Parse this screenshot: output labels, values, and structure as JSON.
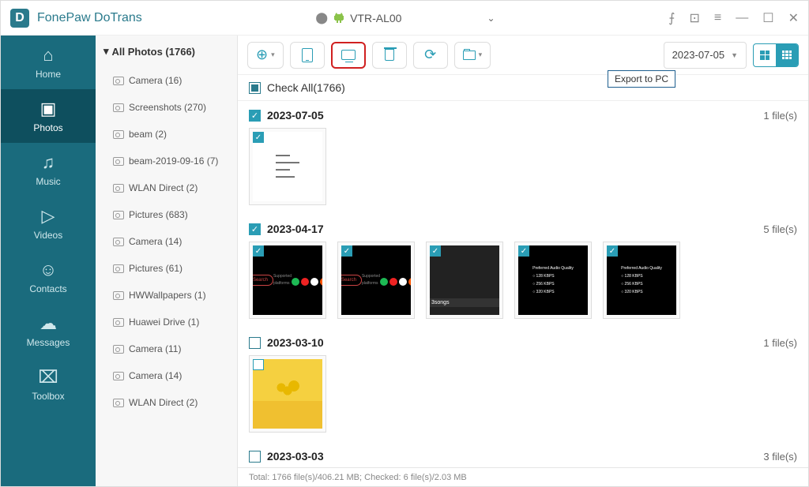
{
  "app": {
    "title": "FonePaw DoTrans"
  },
  "device": {
    "name": "VTR-AL00"
  },
  "nav": {
    "items": [
      {
        "label": "Home",
        "icon": "home"
      },
      {
        "label": "Photos",
        "icon": "photo",
        "active": true
      },
      {
        "label": "Music",
        "icon": "music"
      },
      {
        "label": "Videos",
        "icon": "video"
      },
      {
        "label": "Contacts",
        "icon": "contact"
      },
      {
        "label": "Messages",
        "icon": "message"
      },
      {
        "label": "Toolbox",
        "icon": "toolbox"
      }
    ]
  },
  "sidebar": {
    "header": "All Photos (1766)",
    "albums": [
      {
        "label": "Camera (16)"
      },
      {
        "label": "Screenshots (270)"
      },
      {
        "label": "beam (2)"
      },
      {
        "label": "beam-2019-09-16 (7)"
      },
      {
        "label": "WLAN Direct (2)"
      },
      {
        "label": "Pictures (683)"
      },
      {
        "label": "Camera (14)"
      },
      {
        "label": "Pictures (61)"
      },
      {
        "label": "HWWallpapers (1)"
      },
      {
        "label": "Huawei Drive (1)"
      },
      {
        "label": "Camera (11)"
      },
      {
        "label": "Camera (14)"
      },
      {
        "label": "WLAN Direct (2)"
      }
    ]
  },
  "toolbar": {
    "tooltip": "Export to PC",
    "date_filter": "2023-07-05"
  },
  "checkall": {
    "label": "Check All(1766)"
  },
  "groups": [
    {
      "date": "2023-07-05",
      "count": "1 file(s)",
      "checked": true,
      "thumbs": [
        {
          "checked": true,
          "style": "white"
        }
      ]
    },
    {
      "date": "2023-04-17",
      "count": "5 file(s)",
      "checked": true,
      "thumbs": [
        {
          "checked": true,
          "style": "dark1"
        },
        {
          "checked": true,
          "style": "dark1"
        },
        {
          "checked": true,
          "style": "collage"
        },
        {
          "checked": true,
          "style": "settings"
        },
        {
          "checked": true,
          "style": "settings"
        }
      ]
    },
    {
      "date": "2023-03-10",
      "count": "1 file(s)",
      "checked": false,
      "thumbs": [
        {
          "checked": false,
          "style": "yellow"
        }
      ]
    },
    {
      "date": "2023-03-03",
      "count": "3 file(s)",
      "checked": false,
      "thumbs": []
    }
  ],
  "status": {
    "text": "Total: 1766 file(s)/406.21 MB; Checked: 6 file(s)/2.03 MB"
  }
}
